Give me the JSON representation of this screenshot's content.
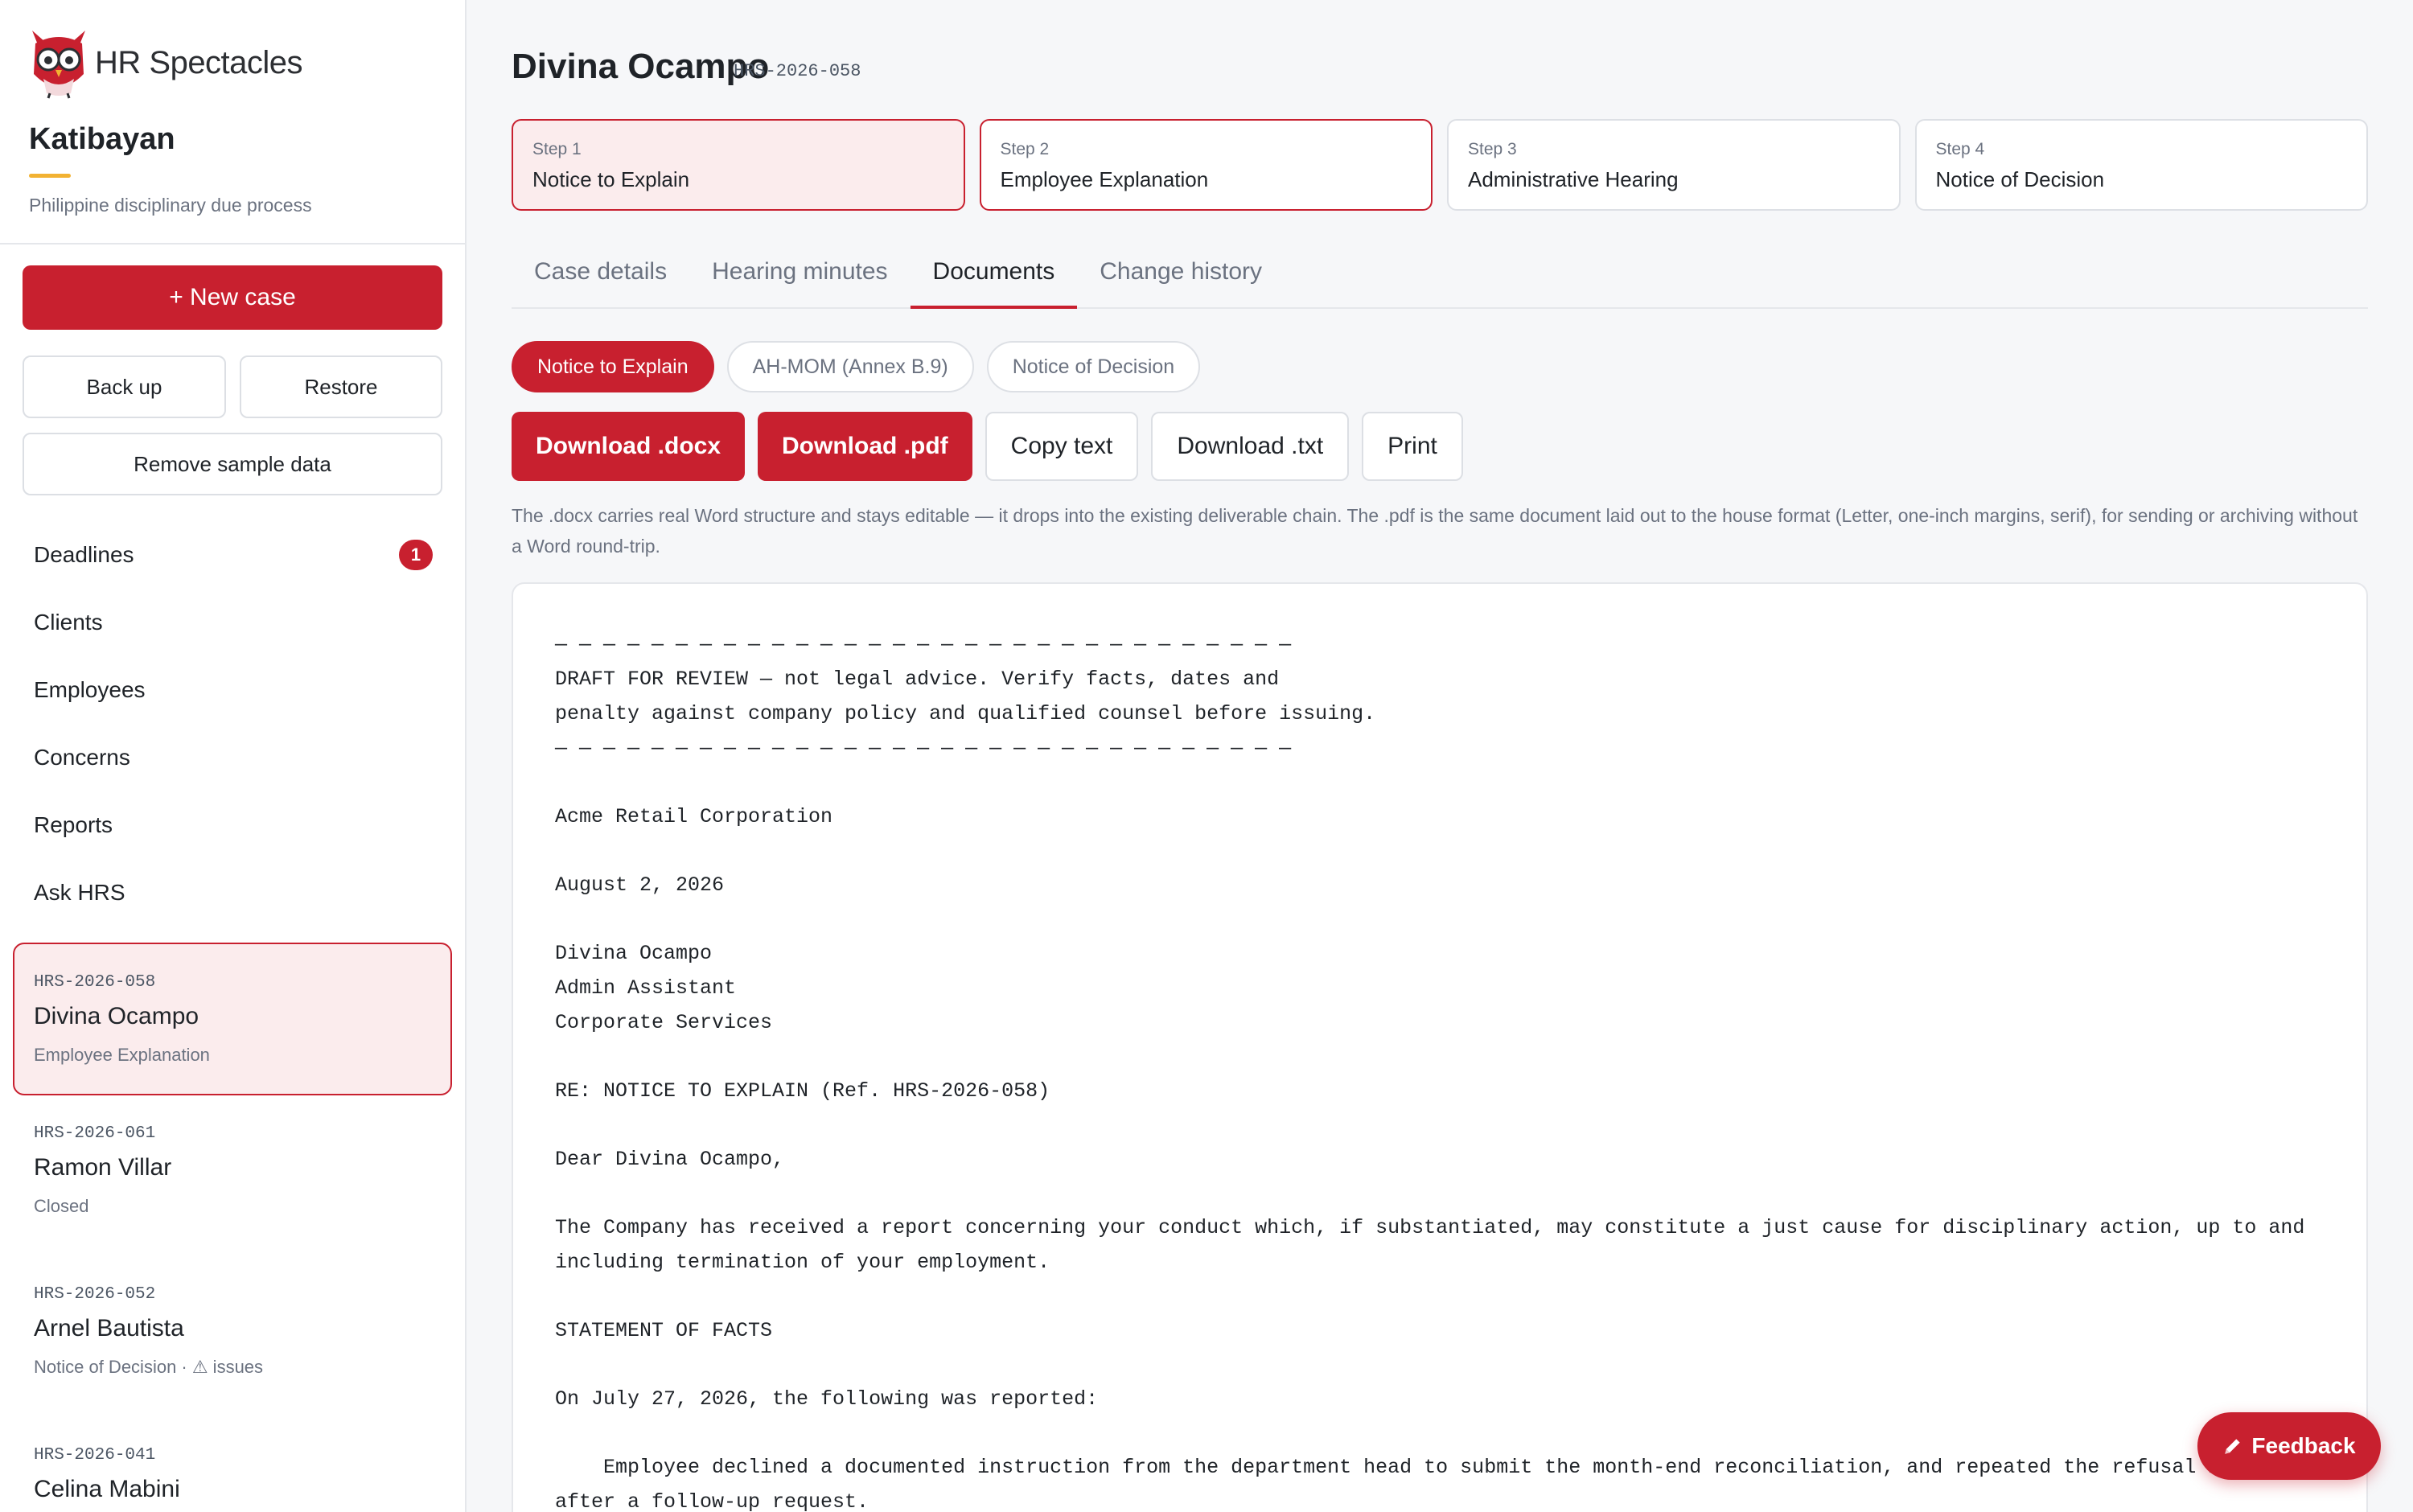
{
  "brand": {
    "name": "HR Spectacles",
    "icon": "owl-logo-icon"
  },
  "org": {
    "title": "Katibayan",
    "subtitle": "Philippine disciplinary due process"
  },
  "sidebar": {
    "new_case_label": "+ New case",
    "backup_label": "Back up",
    "restore_label": "Restore",
    "remove_sample_label": "Remove sample data",
    "nav": [
      {
        "label": "Deadlines",
        "badge": "1"
      },
      {
        "label": "Clients"
      },
      {
        "label": "Employees"
      },
      {
        "label": "Concerns"
      },
      {
        "label": "Reports"
      },
      {
        "label": "Ask HRS"
      }
    ],
    "cases": [
      {
        "ref": "HRS-2026-058",
        "name": "Divina Ocampo",
        "status": "Employee Explanation",
        "active": true
      },
      {
        "ref": "HRS-2026-061",
        "name": "Ramon Villar",
        "status": "Closed"
      },
      {
        "ref": "HRS-2026-052",
        "name": "Arnel Bautista",
        "status": "Notice of Decision · ⚠ issues"
      },
      {
        "ref": "HRS-2026-041",
        "name": "Celina Mabini",
        "status": ""
      }
    ]
  },
  "header": {
    "title": "Divina Ocampo",
    "ref": "HRS-2026-058"
  },
  "steps": [
    {
      "num": "Step 1",
      "label": "Notice to Explain",
      "state": "done"
    },
    {
      "num": "Step 2",
      "label": "Employee Explanation",
      "state": "current"
    },
    {
      "num": "Step 3",
      "label": "Administrative Hearing",
      "state": "pending"
    },
    {
      "num": "Step 4",
      "label": "Notice of Decision",
      "state": "pending"
    }
  ],
  "tabs": [
    "Case details",
    "Hearing minutes",
    "Documents",
    "Change history"
  ],
  "active_tab": "Documents",
  "doc_pills": [
    "Notice to Explain",
    "AH-MOM (Annex B.9)",
    "Notice of Decision"
  ],
  "actions": {
    "download_docx": "Download .docx",
    "download_pdf": "Download .pdf",
    "copy_text": "Copy text",
    "download_txt": "Download .txt",
    "print": "Print"
  },
  "hint": "The .docx carries real Word structure and stays editable — it drops into the existing deliverable chain. The .pdf is the same document laid out to the house format (Letter, one-inch margins, serif), for sending or archiving without a Word round-trip.",
  "document_lines": [
    "— — — — — — — — — — — — — — — — — — — — — — — — — — — — — — —",
    "DRAFT FOR REVIEW — not legal advice. Verify facts, dates and",
    "penalty against company policy and qualified counsel before issuing.",
    "— — — — — — — — — — — — — — — — — — — — — — — — — — — — — — —",
    "",
    "Acme Retail Corporation",
    "",
    "August 2, 2026",
    "",
    "Divina Ocampo",
    "Admin Assistant",
    "Corporate Services",
    "",
    "RE: NOTICE TO EXPLAIN (Ref. HRS-2026-058)",
    "",
    "Dear Divina Ocampo,",
    "",
    "The Company has received a report concerning your conduct which, if substantiated, may constitute a just cause for disciplinary action, up to and",
    "including termination of your employment.",
    "",
    "STATEMENT OF FACTS",
    "",
    "On July 27, 2026, the following was reported:",
    "",
    "    Employee declined a documented instruction from the department head to submit the month-end reconciliation, and repeated the refusal in",
    "after a follow-up request."
  ],
  "feedback_label": "Feedback",
  "colors": {
    "accent": "#c8202f",
    "accent_soft": "#fbeced",
    "gold": "#f2b232"
  }
}
